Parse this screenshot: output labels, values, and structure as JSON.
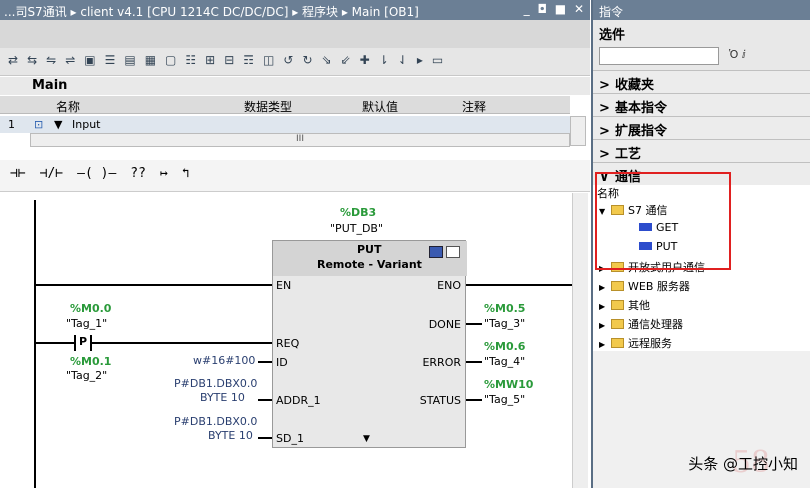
{
  "left": {
    "title": "...司S7通讯 ▸ client v4.1 [CPU 1214C DC/DC/DC] ▸ 程序块 ▸ Main [OB1]",
    "window_controls": "_ ◘ ■ ✕",
    "toolbar_icons": [
      "⇄",
      "⇆",
      "⇋",
      "⇌",
      "▣",
      "☰",
      "▤",
      "▦",
      "▢",
      "☷",
      "⊞",
      "⊟",
      "☶",
      "◫",
      "↺",
      "↻",
      "⇘",
      "⇙",
      "✚",
      "⇂",
      "⇃",
      "▸",
      "▭"
    ],
    "interface": {
      "title": "Main",
      "col_name": "名称",
      "col_type": "数据类型",
      "col_default": "默认值",
      "col_comment": "注释",
      "row_num": "1",
      "row_icon": "⊡",
      "row_toggle": "▼",
      "row_name": "Input",
      "scroll_mark": "III"
    },
    "ladder_toolbar": [
      "⊣⊢",
      "⊣/⊢",
      "–( )–",
      "??",
      "↦",
      "↰"
    ],
    "block": {
      "db_addr": "%DB3",
      "db_name": "\"PUT_DB\"",
      "name": "PUT",
      "subtitle": "Remote - Variant",
      "pins_left": [
        "EN",
        "REQ",
        "ID",
        "ADDR_1",
        "SD_1"
      ],
      "pins_right": [
        "ENO",
        "DONE",
        "ERROR",
        "STATUS"
      ],
      "expand": "▼"
    },
    "tags": {
      "m00_addr": "%M0.0",
      "m00_name": "\"Tag_1\"",
      "p_contact": "P",
      "m01_addr": "%M0.1",
      "m01_name": "\"Tag_2\"",
      "id_val": "w#16#100",
      "addr1_a": "P#DB1.DBX0.0",
      "addr1_b": "BYTE 10",
      "sd1_a": "P#DB1.DBX0.0",
      "sd1_b": "BYTE 10",
      "done_addr": "%M0.5",
      "done_name": "\"Tag_3\"",
      "error_addr": "%M0.6",
      "error_name": "\"Tag_4\"",
      "status_addr": "%MW10",
      "status_name": "\"Tag_5\""
    }
  },
  "right": {
    "title": "指令",
    "options": "选件",
    "search_placeholder": "",
    "search_icons": "Ὁ ⅈ",
    "sections": [
      {
        "arrow": ">",
        "label": "收藏夹"
      },
      {
        "arrow": ">",
        "label": "基本指令"
      },
      {
        "arrow": ">",
        "label": "扩展指令"
      },
      {
        "arrow": ">",
        "label": "工艺"
      },
      {
        "arrow": "∨",
        "label": "通信"
      }
    ],
    "name_header": "名称",
    "tree": [
      {
        "level": 0,
        "toggle": "▼",
        "type": "folder",
        "label": "S7 通信"
      },
      {
        "level": 1,
        "toggle": "",
        "type": "block",
        "label": "GET"
      },
      {
        "level": 1,
        "toggle": "",
        "type": "block",
        "label": "PUT"
      },
      {
        "level": 0,
        "toggle": "▶",
        "type": "folder",
        "label": "开放式用户通信"
      },
      {
        "level": 0,
        "toggle": "▶",
        "type": "folder",
        "label": "WEB 服务器"
      },
      {
        "level": 0,
        "toggle": "▶",
        "type": "folder",
        "label": "其他"
      },
      {
        "level": 0,
        "toggle": "▶",
        "type": "folder",
        "label": "通信处理器"
      },
      {
        "level": 0,
        "toggle": "▶",
        "type": "folder",
        "label": "远程服务"
      }
    ]
  },
  "watermark": "头条 @工控小知",
  "watermark_ghost": "58"
}
